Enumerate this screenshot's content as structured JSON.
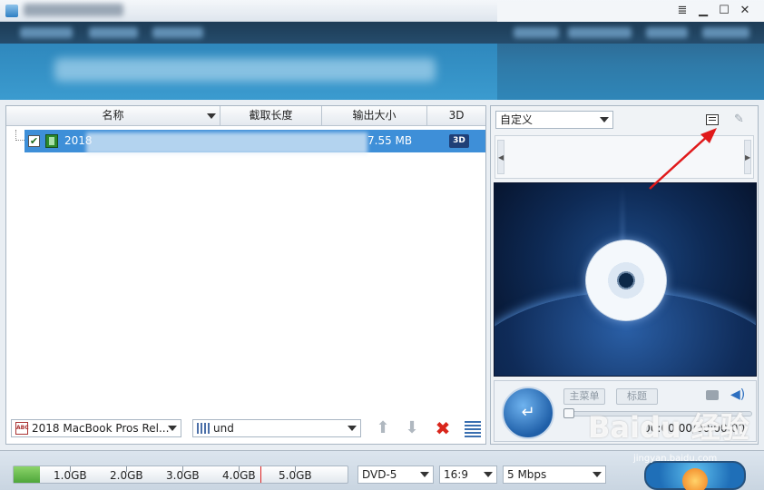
{
  "window": {
    "minimize_glyph": "▁",
    "restore_glyph": "☐",
    "close_glyph": "✕",
    "menu_glyph": "≣"
  },
  "file_list": {
    "columns": [
      "名称",
      "截取长度",
      "输出大小",
      "3D"
    ],
    "rows": [
      {
        "name_prefix": "2018",
        "output_size": "7.55 MB",
        "checked": "✔",
        "badge_3d": "3D"
      }
    ]
  },
  "bottom_bar": {
    "subtitle_select": "2018 MacBook Pros Rel...",
    "audio_select": "und",
    "up_glyph": "⬆",
    "down_glyph": "⬇",
    "delete_glyph": "✖"
  },
  "preview": {
    "profile_select": "自定义",
    "main_menu_button": "主菜单",
    "title_button": "标题",
    "time_display": "00:00:00/00:00:00",
    "play_glyph": "↵"
  },
  "status": {
    "capacity_labels": [
      "1.0GB",
      "2.0GB",
      "3.0GB",
      "4.0GB",
      "5.0GB"
    ],
    "capacity_used_fraction": 0.08,
    "disc_type": "DVD-5",
    "aspect_ratio": "16:9",
    "bitrate": "5 Mbps"
  },
  "watermark": {
    "text": "Baidu 经验",
    "sub": "jingyan.baidu.com"
  },
  "colors": {
    "selection": "#3e8fd8",
    "header": "#2f7aa8",
    "annotation_arrow": "#e0191a"
  }
}
